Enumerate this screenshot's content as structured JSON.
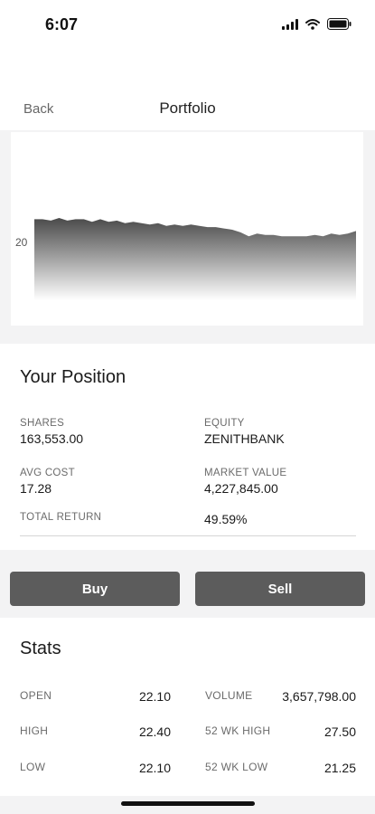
{
  "status_bar": {
    "time": "6:07"
  },
  "nav": {
    "back_label": "Back",
    "title": "Portfolio"
  },
  "chart_data": {
    "type": "area",
    "y_tick_labels": [
      "20"
    ],
    "x": [
      0,
      1,
      2,
      3,
      4,
      5,
      6,
      7,
      8,
      9,
      10,
      11,
      12,
      13,
      14,
      15,
      16,
      17,
      18,
      19,
      20,
      21,
      22,
      23,
      24,
      25,
      26,
      27,
      28,
      29,
      30,
      31,
      32,
      33,
      34,
      35,
      36,
      37,
      38,
      39
    ],
    "y": [
      22.1,
      22.1,
      22.05,
      22.15,
      22.05,
      22.1,
      22.1,
      22.0,
      22.1,
      22.0,
      22.05,
      21.95,
      22.0,
      21.95,
      21.9,
      21.95,
      21.85,
      21.9,
      21.85,
      21.9,
      21.85,
      21.8,
      21.8,
      21.75,
      21.7,
      21.6,
      21.45,
      21.55,
      21.5,
      21.5,
      21.45,
      21.45,
      21.45,
      21.45,
      21.5,
      21.45,
      21.55,
      21.5,
      21.55,
      21.65
    ],
    "ylim": [
      19.0,
      22.6
    ],
    "grid": false,
    "colors": {
      "fill_top": "#4a4a4a",
      "fill_bottom": "#ffffff"
    }
  },
  "position": {
    "heading": "Your Position",
    "shares_label": "SHARES",
    "shares_value": "163,553.00",
    "equity_label": "EQUITY",
    "equity_value": "ZENITHBANK",
    "avg_cost_label": "AVG COST",
    "avg_cost_value": "17.28",
    "market_value_label": "MARKET VALUE",
    "market_value_value": "4,227,845.00",
    "total_return_label": "TOTAL RETURN",
    "total_return_value": "49.59%"
  },
  "actions": {
    "buy_label": "Buy",
    "sell_label": "Sell"
  },
  "stats": {
    "heading": "Stats",
    "open_label": "OPEN",
    "open_value": "22.10",
    "high_label": "HIGH",
    "high_value": "22.40",
    "low_label": "LOW",
    "low_value": "22.10",
    "volume_label": "VOLUME",
    "volume_value": "3,657,798.00",
    "wk52_high_label": "52 WK HIGH",
    "wk52_high_value": "27.50",
    "wk52_low_label": "52 WK LOW",
    "wk52_low_value": "21.25"
  },
  "colors": {
    "button_bg": "#5c5c5c",
    "section_bg": "#f3f3f4"
  }
}
